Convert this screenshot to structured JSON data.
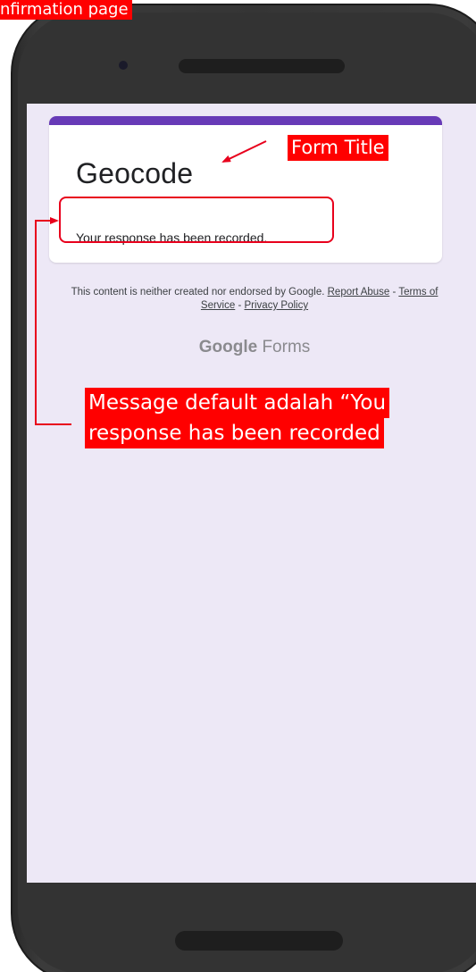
{
  "annotations": {
    "confirmation_page_label": "nfirmation page",
    "form_title_label": "Form Title",
    "message_line_1": "Message default adalah “You",
    "message_line_2": "response has been recorded"
  },
  "form": {
    "title": "Geocode",
    "confirmation_message": "Your response has been recorded."
  },
  "footer": {
    "disclaimer": "This content is neither created nor endorsed by Google.",
    "report_abuse": "Report Abuse",
    "separator_1": " - ",
    "terms": "Terms of Service",
    "separator_2": " - ",
    "privacy": "Privacy Policy"
  },
  "branding": {
    "google": "Google",
    "forms": "Forms"
  },
  "colors": {
    "accent": "#673ab7",
    "screen_background": "#ede8f6",
    "annotation_red": "#ff0000"
  },
  "icons": [
    "phone-camera-icon",
    "annotation-arrow-icon"
  ]
}
